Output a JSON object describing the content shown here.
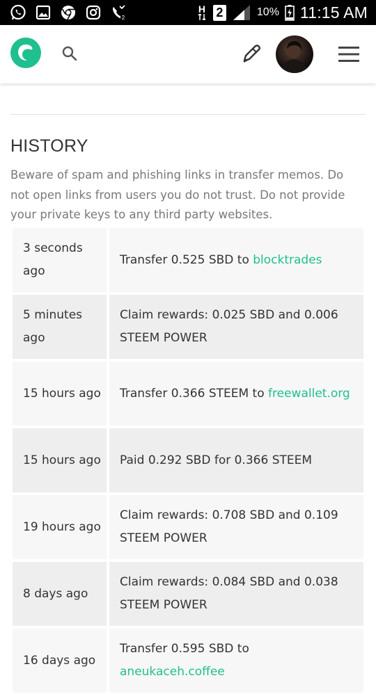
{
  "status_bar": {
    "network_type": "H",
    "sim_slot": "2",
    "battery": "10%",
    "time": "11:15 AM"
  },
  "header": {
    "logo_icon": "steemit-logo-icon",
    "search_icon": "search-icon",
    "compose_icon": "pen-icon",
    "avatar": "user-avatar",
    "menu_icon": "hamburger-menu-icon",
    "brand_color": "#1fbf8f"
  },
  "history": {
    "heading": "HISTORY",
    "warning": "Beware of spam and phishing links in transfer memos. Do not open links from users you do not trust. Do not provide your private keys to any third party websites.",
    "rows": [
      {
        "time": "3 seconds ago",
        "desc": "Transfer 0.525 SBD to ",
        "link": "blocktrades"
      },
      {
        "time": "5 minutes ago",
        "desc": "Claim rewards: 0.025 SBD and 0.006 STEEM POWER",
        "link": ""
      },
      {
        "time": "15 hours ago",
        "desc": "Transfer 0.366 STEEM to ",
        "link": "freewallet.org"
      },
      {
        "time": "15 hours ago",
        "desc": "Paid 0.292 SBD for 0.366 STEEM",
        "link": ""
      },
      {
        "time": "19 hours ago",
        "desc": "Claim rewards: 0.708 SBD and 0.109 STEEM POWER",
        "link": ""
      },
      {
        "time": "8 days ago",
        "desc": "Claim rewards: 0.084 SBD and 0.038 STEEM POWER",
        "link": ""
      },
      {
        "time": "16 days ago",
        "desc": "Transfer 0.595 SBD to ",
        "link": "aneukaceh.coffee"
      }
    ]
  }
}
